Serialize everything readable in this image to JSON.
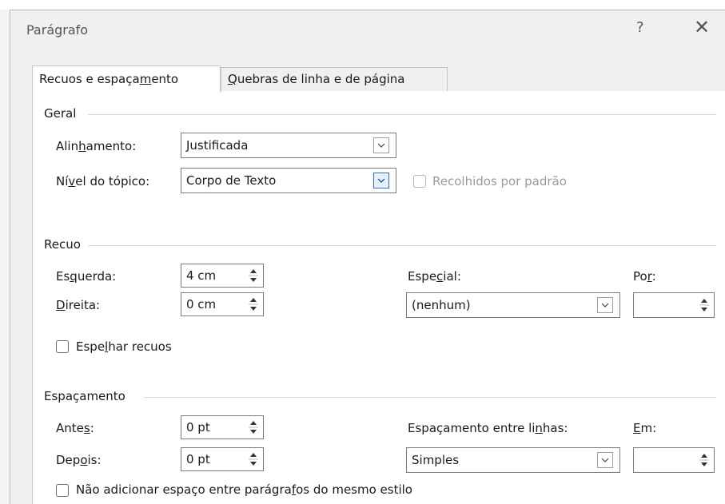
{
  "dialog": {
    "title": "Parágrafo",
    "help_label": "?",
    "close_label": "✕"
  },
  "tabs": {
    "indents": {
      "pre": "Recuos e espaça",
      "key": "m",
      "post": "ento"
    },
    "breaks": {
      "pre": "",
      "key": "Q",
      "post": "uebras de linha e de página"
    }
  },
  "general": {
    "section_label": "Geral",
    "alignment": {
      "pre": "Alin",
      "key": "h",
      "post": "amento:",
      "value": "Justificada"
    },
    "outline_level": {
      "pre": "Ní",
      "key": "v",
      "post": "el do tópico:",
      "value": "Corpo de Texto"
    },
    "collapsed_label": "Recolhidos por padrão"
  },
  "indent": {
    "section_label": "Recuo",
    "left": {
      "pre": "Es",
      "key": "q",
      "post": "uerda:",
      "value": "4 cm"
    },
    "right": {
      "pre": "",
      "key": "D",
      "post": "ireita:",
      "value": "0 cm"
    },
    "special": {
      "pre": "Espe",
      "key": "c",
      "post": "ial:",
      "value": "(nenhum)"
    },
    "by": {
      "pre": "Po",
      "key": "r",
      "post": ":",
      "value": ""
    },
    "mirror": {
      "pre": "Espe",
      "key": "l",
      "post": "har recuos"
    }
  },
  "spacing": {
    "section_label": "Espaçamento",
    "before": {
      "pre": "Ante",
      "key": "s",
      "post": ":",
      "value": "0 pt"
    },
    "after": {
      "pre": "Dep",
      "key": "o",
      "post": "is:",
      "value": "0 pt"
    },
    "line_spacing": {
      "pre": "Espaçamento entre li",
      "key": "n",
      "post": "has:",
      "value": "Simples"
    },
    "at": {
      "pre": "",
      "key": "E",
      "post": "m:",
      "value": ""
    },
    "dont_add": {
      "pre": "Não adicionar espaço entre parágra",
      "key": "f",
      "post": "os do mesmo estilo"
    }
  },
  "colors": {
    "dialog_bg": "#f0f0f0",
    "panel_bg": "#ffffff",
    "focus_border": "#2f6ecb"
  }
}
